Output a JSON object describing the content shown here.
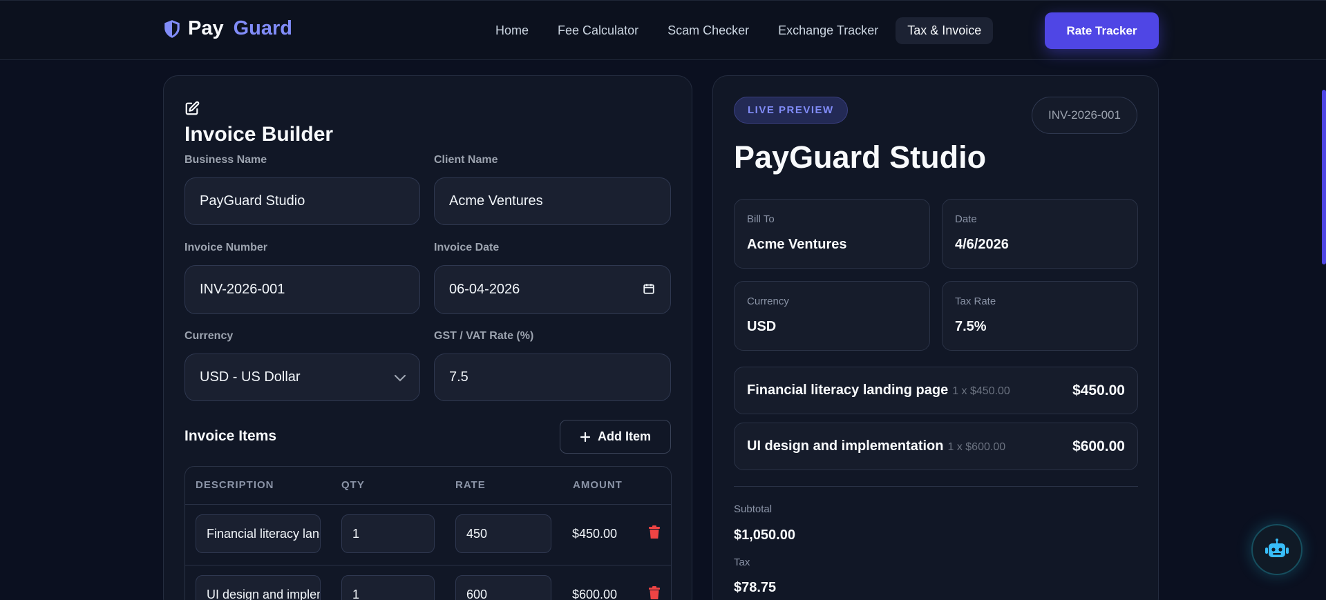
{
  "brand": {
    "first": "Pay",
    "second": "Guard",
    "icon": "shield-icon"
  },
  "nav": {
    "links": [
      "Home",
      "Fee Calculator",
      "Scam Checker",
      "Exchange Tracker",
      "Tax & Invoice"
    ],
    "active": "Tax & Invoice",
    "cta": "Rate Tracker"
  },
  "builder": {
    "title": "Invoice Builder",
    "business_name_label": "Business Name",
    "business_name": "PayGuard Studio",
    "client_name_label": "Client Name",
    "client_name": "Acme Ventures",
    "invoice_number_label": "Invoice Number",
    "invoice_number": "INV-2026-001",
    "invoice_date_label": "Invoice Date",
    "invoice_date": "06-04-2026",
    "currency_label": "Currency",
    "currency": "USD - US Dollar",
    "tax_label": "GST / VAT Rate (%)",
    "tax_rate": "7.5",
    "items_title": "Invoice Items",
    "add_item": "Add Item",
    "columns": [
      "DESCRIPTION",
      "QTY",
      "RATE",
      "AMOUNT"
    ],
    "rows": [
      {
        "description": "Financial literacy landing page",
        "qty": "1",
        "rate": "450",
        "amount": "$450.00"
      },
      {
        "description": "UI design and implementation",
        "qty": "1",
        "rate": "600",
        "amount": "$600.00"
      }
    ]
  },
  "preview": {
    "badge": "LIVE PREVIEW",
    "invoice_number": "INV-2026-001",
    "business": "PayGuard Studio",
    "bill_to_label": "Bill To",
    "bill_to": "Acme Ventures",
    "date_label": "Date",
    "date": "4/6/2026",
    "currency_label": "Currency",
    "currency": "USD",
    "tax_rate_label": "Tax Rate",
    "tax_rate": "7.5%",
    "items": [
      {
        "description": "Financial literacy landing page",
        "meta": "1 x $450.00",
        "total": "$450.00"
      },
      {
        "description": "UI design and implementation",
        "meta": "1 x $600.00",
        "total": "$600.00"
      }
    ],
    "subtotal_label": "Subtotal",
    "subtotal": "$1,050.00",
    "tax_label": "Tax",
    "tax": "$78.75"
  },
  "colors": {
    "accent": "#4f46e5",
    "brand_accent": "#818cf8",
    "danger": "#ef4444",
    "bot": "#38bdf8"
  }
}
